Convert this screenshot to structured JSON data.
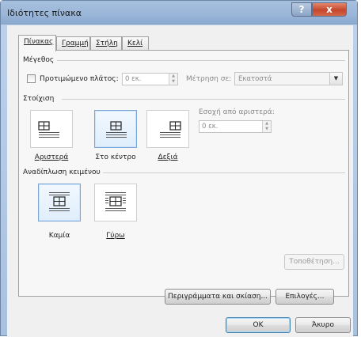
{
  "window": {
    "title": "Ιδιότητες πίνακα",
    "help_glyph": "?",
    "close_glyph": "x"
  },
  "tabs": [
    {
      "label": "Πίνακας",
      "active": true
    },
    {
      "label": "Γραμμή",
      "active": false
    },
    {
      "label": "Στήλη",
      "active": false
    },
    {
      "label": "Κελί",
      "active": false
    }
  ],
  "size": {
    "section_title": "Μέγεθος",
    "preferred_width_label": "Προτιμώμενο πλάτος:",
    "preferred_width_checked": false,
    "preferred_width_value": "0 εκ.",
    "measure_in_label": "Μέτρηση σε:",
    "measure_in_value": "Εκατοστά"
  },
  "alignment": {
    "section_title": "Στοίχιση",
    "options": [
      {
        "label": "Αριστερά",
        "icon": "table-align-left-icon",
        "selected": false
      },
      {
        "label": "Στο κέντρο",
        "icon": "table-align-center-icon",
        "selected": true
      },
      {
        "label": "Δεξιά",
        "icon": "table-align-right-icon",
        "selected": false
      }
    ],
    "indent_label": "Εσοχή από αριστερά:",
    "indent_value": "0 εκ."
  },
  "text_wrapping": {
    "section_title": "Αναδίπλωση κειμένου",
    "options": [
      {
        "label": "Καμία",
        "icon": "wrap-none-icon",
        "selected": true
      },
      {
        "label": "Γύρω",
        "icon": "wrap-around-icon",
        "selected": false
      }
    ],
    "positioning_button": "Τοποθέτηση..."
  },
  "buttons": {
    "borders_shading": "Περιγράμματα και σκίαση...",
    "options": "Επιλογές...",
    "ok": "OK",
    "cancel": "Άκυρο"
  },
  "colors": {
    "selection_border": "#7aa7d6",
    "titlebar": "#9ab6d8",
    "close_button": "#c3472c"
  }
}
